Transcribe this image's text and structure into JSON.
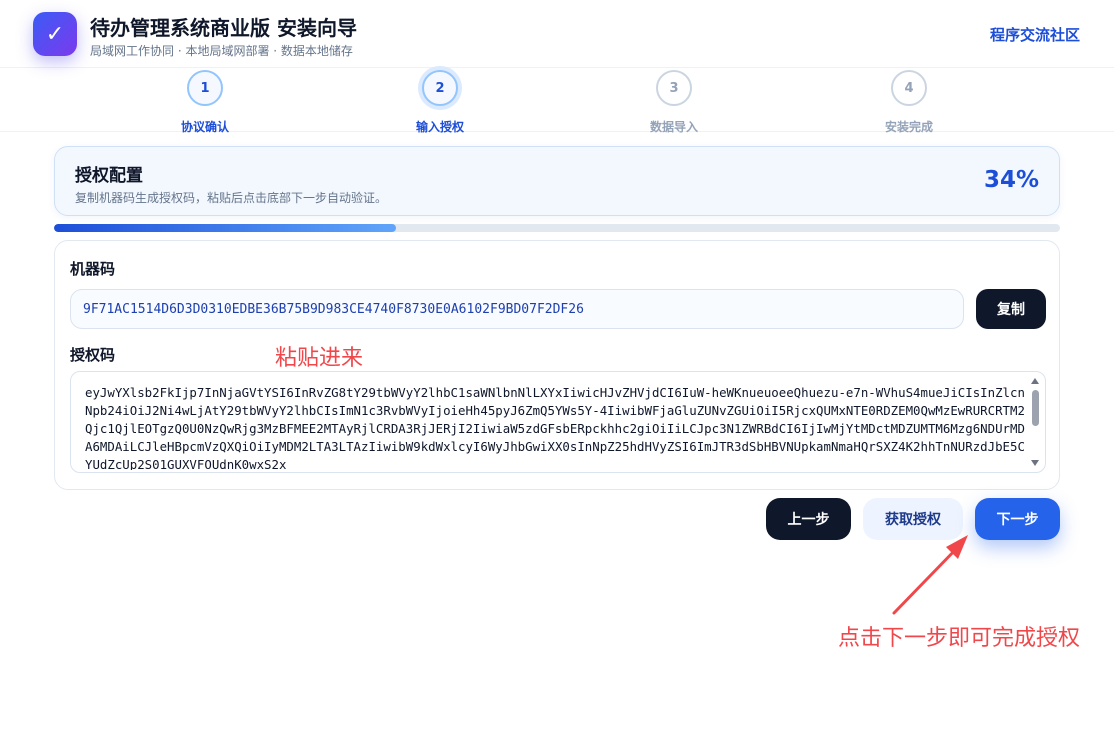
{
  "header": {
    "logo_glyph": "✓",
    "title": "待办管理系统商业版 安装向导",
    "subtitle": "局域网工作协同 · 本地局域网部署 · 数据本地储存",
    "community_link": "程序交流社区"
  },
  "steps": [
    {
      "number": "1",
      "label": "协议确认",
      "state": "done"
    },
    {
      "number": "2",
      "label": "输入授权",
      "state": "active"
    },
    {
      "number": "3",
      "label": "数据导入",
      "state": "pending"
    },
    {
      "number": "4",
      "label": "安装完成",
      "state": "pending"
    }
  ],
  "config": {
    "title": "授权配置",
    "description": "复制机器码生成授权码，粘贴后点击底部下一步自动验证。",
    "percent_text": "34%",
    "progress": 0.34
  },
  "form": {
    "machine_label": "机器码",
    "machine_code": "9F71AC1514D6D3D0310EDBE36B75B9D983CE4740F8730E0A6102F9BD07F2DF26",
    "copy_button": "复制",
    "license_label": "授权码",
    "license_code": "eyJwYXlsb2FkIjp7InNjaGVtYSI6InRvZG8tY29tbWVyY2lhbC1saWNlbnNlLXYxIiwicHJvZHVjdCI6IuW-heWKnueuoeeQhuezu-e7n-WVhuS4mueJiCIsInZlcnNpb24iOiJ2Ni4wLjAtY29tbWVyY2lhbCIsImN1c3RvbWVyIjoieHh45pyJ6ZmQ5YWs5Y-4IiwibWFjaGluZUNvZGUiOiI5RjcxQUMxNTE0RDZEM0QwMzEwRURCRTM2Qjc1QjlEOTgzQ0U0NzQwRjg3MzBFMEE2MTAyRjlCRDA3RjJERjI2IiwiaW5zdGFsbERpckhhc2giOiIiLCJpc3N1ZWRBdCI6IjIwMjYtMDctMDZUMTM6Mzg6NDUrMDA6MDAiLCJleHBpcmVzQXQiOiIyMDM2LTA3LTAzIiwibW9kdWxlcyI6WyJhbGwiXX0sInNpZ25hdHVyZSI6ImJTR3dSbHBVNUpkamNmaHQrSXZ4K2hhTnNURzdJbE5CYUdZcUp2S01GUXVFOUdnK0wxS2x"
  },
  "buttons": {
    "prev": "上一步",
    "get_license": "获取授权",
    "next": "下一步"
  },
  "annotations": {
    "paste_here": "粘贴进来",
    "click_next": "点击下一步即可完成授权"
  },
  "colors": {
    "accent": "#2563eb",
    "dark": "#0f172a",
    "annotation": "#f0474b"
  }
}
